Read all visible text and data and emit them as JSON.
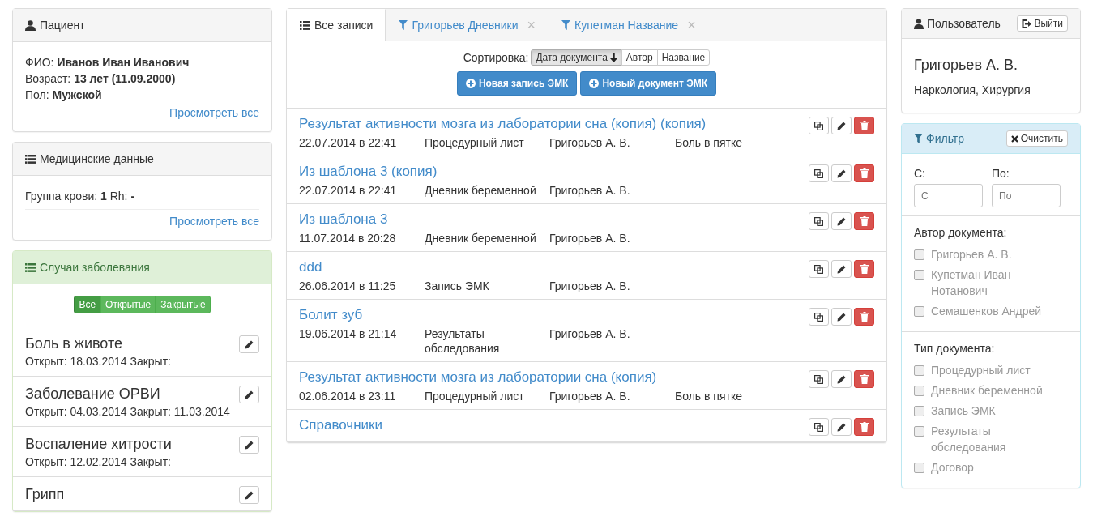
{
  "patient": {
    "title": "Пациент",
    "fields": [
      {
        "label": "ФИО:",
        "value": "Иванов Иван Иванович"
      },
      {
        "label": "Возраст:",
        "value": "13 лет (11.09.2000)"
      },
      {
        "label": "Пол:",
        "value": "Мужской"
      }
    ],
    "link": "Просмотреть все"
  },
  "medical": {
    "title": "Медицинские данные",
    "blood_label": "Группа крови:",
    "blood_group": "1",
    "rh_label": "Rh:",
    "rh": "-",
    "link": "Просмотреть все"
  },
  "cases": {
    "title": "Случаи заболевания",
    "filters": [
      {
        "label": "Все",
        "selected": true
      },
      {
        "label": "Открытые",
        "selected": false
      },
      {
        "label": "Закрытые",
        "selected": false
      }
    ],
    "items": [
      {
        "title": "Боль в животе",
        "details": "Открыт: 18.03.2014 Закрыт:"
      },
      {
        "title": "Заболевание ОРВИ",
        "details": "Открыт: 04.03.2014 Закрыт: 11.03.2014"
      },
      {
        "title": "Воспаление хитрости",
        "details": "Открыт: 12.02.2014 Закрыт:"
      },
      {
        "title": "Грипп"
      }
    ]
  },
  "tabs": [
    {
      "label": "Все записи",
      "kind": "list",
      "selected": true
    },
    {
      "label": "Григорьев Дневники",
      "kind": "filter",
      "close": "×",
      "selected": false
    },
    {
      "label": "Купетман Название",
      "kind": "filter",
      "close": "×",
      "selected": false
    }
  ],
  "sort": {
    "label": "Сортировка:",
    "options": [
      {
        "label": "Дата документа",
        "selected": true
      },
      {
        "label": "Автор",
        "selected": false
      },
      {
        "label": "Название",
        "selected": false
      }
    ]
  },
  "actions": [
    "Новая запись ЭМК",
    "Новый документ ЭМК"
  ],
  "records": [
    {
      "title": "Результат активности мозга из лаборатории сна (копия) (копия)",
      "date": "22.07.2014 в 22:41",
      "doc_type": "Процедурный лист",
      "author": "Григорьев А. В.",
      "illness": "Боль в пятке"
    },
    {
      "title": "Из шаблона 3 (копия)",
      "date": "22.07.2014 в 22:41",
      "doc_type": "Дневник беременной",
      "author": "Григорьев А. В."
    },
    {
      "title": "Из шаблона 3",
      "date": "11.07.2014 в 20:28",
      "doc_type": "Дневник беременной",
      "author": "Григорьев А. В."
    },
    {
      "title": "ddd",
      "date": "26.06.2014 в 11:25",
      "doc_type": "Запись ЭМК",
      "author": "Григорьев А. В."
    },
    {
      "title": "Болит зуб",
      "date": "19.06.2014 в 21:14",
      "doc_type": "Результаты обследования",
      "author": "Григорьев А. В."
    },
    {
      "title": "Результат активности мозга из лаборатории сна (копия)",
      "date": "02.06.2014 в 23:11",
      "doc_type": "Процедурный лист",
      "author": "Григорьев А. В.",
      "illness": "Боль в пятке"
    },
    {
      "title": "Справочники"
    }
  ],
  "user": {
    "title": "Пользователь",
    "logout": "Выйти",
    "name": "Григорьев А. В.",
    "departments": "Наркология, Хирургия"
  },
  "filter": {
    "title": "Фильтр",
    "clear": "Очистить",
    "from_label": "С:",
    "from_placeholder": "С",
    "to_label": "По:",
    "to_placeholder": "По",
    "author_title": "Автор документа:",
    "authors": [
      {
        "label": "Григорьев А. В.",
        "checked": false
      },
      {
        "label": "Купетман Иван Нотанович",
        "checked": false
      },
      {
        "label": "Семашенков Андрей",
        "checked": false
      }
    ],
    "type_title": "Тип документа:",
    "types": [
      {
        "label": "Процедурный лист",
        "checked": false
      },
      {
        "label": "Дневник беременной",
        "checked": false
      },
      {
        "label": "Запись ЭМК",
        "checked": false
      },
      {
        "label": "Результаты обследования",
        "checked": false
      },
      {
        "label": "Договор",
        "checked": false
      }
    ]
  }
}
